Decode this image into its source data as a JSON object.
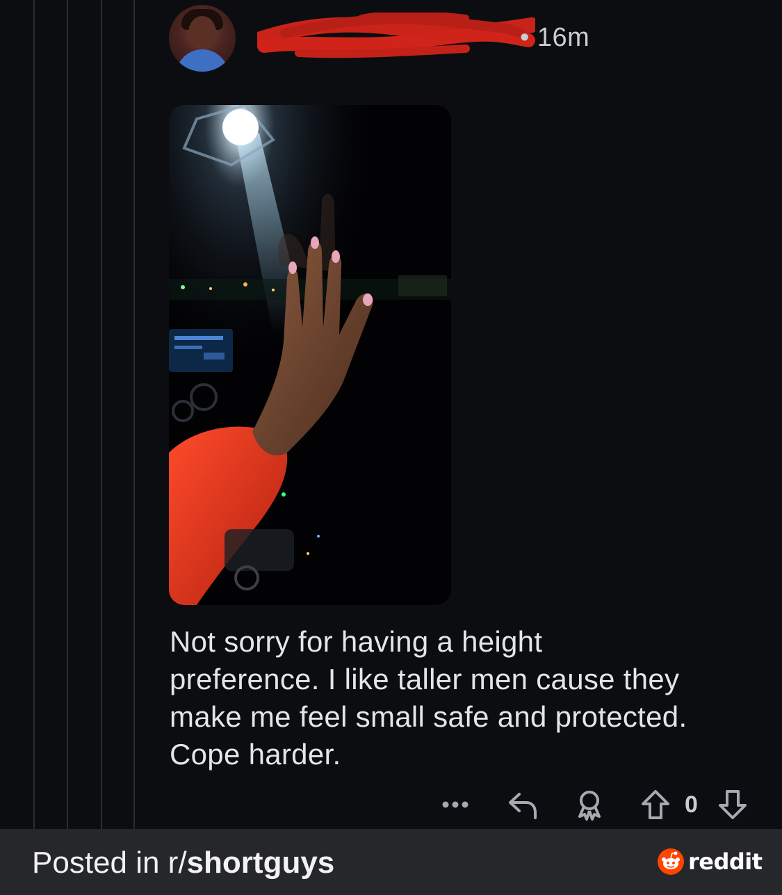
{
  "comment": {
    "author_avatar_icon": "user-avatar",
    "author_redacted": true,
    "timestamp": "• 16m",
    "image_alt_icon": "photo-hand-in-car",
    "body_lines": [
      "Not sorry for having a height",
      "preference. I like taller men cause they",
      "make me feel small safe and protected.",
      "Cope harder."
    ],
    "actions": {
      "more_icon": "more-dots-icon",
      "reply_icon": "reply-icon",
      "award_icon": "award-icon",
      "upvote_icon": "upvote-icon",
      "downvote_icon": "downvote-icon",
      "vote_count": "0"
    }
  },
  "footer": {
    "prefix": "Posted in r/",
    "subreddit": "shortguys",
    "brand": "reddit",
    "brand_color": "#ff4500"
  },
  "colors": {
    "background": "#0b0d10",
    "redaction": "#d0241b",
    "footer_bg": "#25272a"
  }
}
